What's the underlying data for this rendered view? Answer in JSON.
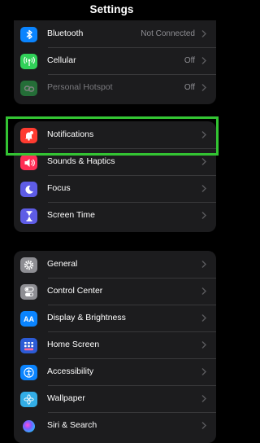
{
  "header": {
    "title": "Settings"
  },
  "group1": [
    {
      "label": "Bluetooth",
      "value": "Not Connected",
      "icon": "bluetooth-icon",
      "color": "#0a84ff"
    },
    {
      "label": "Cellular",
      "value": "Off",
      "icon": "cellular-antenna-icon",
      "color": "#30d158"
    },
    {
      "label": "Personal Hotspot",
      "value": "Off",
      "icon": "hotspot-chain-icon",
      "color": "#30d158"
    }
  ],
  "group2": [
    {
      "label": "Notifications",
      "icon": "bell-icon",
      "color": "#ff3b30"
    },
    {
      "label": "Sounds & Haptics",
      "icon": "speaker-icon",
      "color": "#ff2d55"
    },
    {
      "label": "Focus",
      "icon": "moon-icon",
      "color": "#5e5ce6"
    },
    {
      "label": "Screen Time",
      "icon": "hourglass-icon",
      "color": "#5e5ce6"
    }
  ],
  "group3": [
    {
      "label": "General",
      "icon": "gear-icon",
      "color": "#8e8e93"
    },
    {
      "label": "Control Center",
      "icon": "toggles-icon",
      "color": "#8e8e93"
    },
    {
      "label": "Display & Brightness",
      "icon": "text-size-icon",
      "color": "#0a84ff",
      "glyph": "AA"
    },
    {
      "label": "Home Screen",
      "icon": "app-grid-icon",
      "color": "#2c5bd6"
    },
    {
      "label": "Accessibility",
      "icon": "accessibility-person-icon",
      "color": "#0a84ff"
    },
    {
      "label": "Wallpaper",
      "icon": "flower-icon",
      "color": "#32ade6"
    },
    {
      "label": "Siri & Search",
      "icon": "siri-orb-icon",
      "color": "#1c1c1e"
    }
  ],
  "highlight_color": "#33c433"
}
